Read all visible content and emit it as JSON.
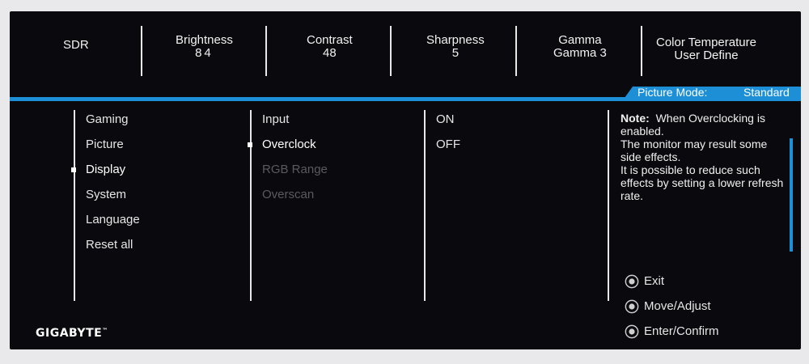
{
  "top": {
    "sdr": "SDR",
    "brightness": {
      "label": "Brightness",
      "value": "84"
    },
    "contrast": {
      "label": "Contrast",
      "value": "48"
    },
    "sharpness": {
      "label": "Sharpness",
      "value": "5"
    },
    "gamma": {
      "label": "Gamma",
      "value": "Gamma 3"
    },
    "color_temp": {
      "label": "Color Temperature",
      "value": "User Define"
    }
  },
  "picture_mode": {
    "label": "Picture Mode:",
    "value": "Standard"
  },
  "menu": {
    "main": [
      "Gaming",
      "Picture",
      "Display",
      "System",
      "Language",
      "Reset all"
    ],
    "main_selected": "Display",
    "sub": [
      "Input",
      "Overclock",
      "RGB Range",
      "Overscan"
    ],
    "sub_selected": "Overclock",
    "options": [
      "ON",
      "OFF"
    ]
  },
  "note": {
    "label": "Note:",
    "line1": "When Overclocking is enabled.",
    "line2": "The monitor may result some side effects.",
    "line3": "It is possible to reduce such effects by setting a lower refresh rate."
  },
  "nav": {
    "exit": "Exit",
    "move": "Move/Adjust",
    "enter": "Enter/Confirm"
  },
  "brand": {
    "name": "GIGABYTE",
    "tm": "™"
  },
  "colors": {
    "accent": "#1c8fd6",
    "background": "#0a0a0e"
  }
}
